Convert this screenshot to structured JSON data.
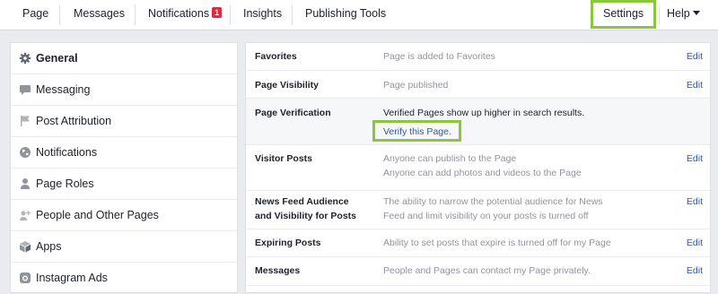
{
  "topnav": {
    "page": "Page",
    "messages": "Messages",
    "notifications": "Notifications",
    "notifications_count": "1",
    "insights": "Insights",
    "publishing_tools": "Publishing Tools",
    "settings": "Settings",
    "help": "Help"
  },
  "sidebar": {
    "items": [
      {
        "label": "General",
        "icon": "gear-icon"
      },
      {
        "label": "Messaging",
        "icon": "message-icon"
      },
      {
        "label": "Post Attribution",
        "icon": "flag-icon"
      },
      {
        "label": "Notifications",
        "icon": "globe-icon"
      },
      {
        "label": "Page Roles",
        "icon": "person-icon"
      },
      {
        "label": "People and Other Pages",
        "icon": "people-icon"
      },
      {
        "label": "Apps",
        "icon": "cube-icon"
      },
      {
        "label": "Instagram Ads",
        "icon": "camera-icon"
      }
    ]
  },
  "settings": {
    "edit_label": "Edit",
    "rows": [
      {
        "title": "Favorites",
        "lines": [
          "Page is added to Favorites"
        ]
      },
      {
        "title": "Page Visibility",
        "lines": [
          "Page published"
        ]
      },
      {
        "title": "Page Verification",
        "lines": [
          "Verified Pages show up higher in search results."
        ],
        "link": "Verify this Page."
      },
      {
        "title": "Visitor Posts",
        "lines": [
          "Anyone can publish to the Page",
          "Anyone can add photos and videos to the Page"
        ]
      },
      {
        "title": "News Feed Audience and Visibility for Posts",
        "lines": [
          "The ability to narrow the potential audience for News Feed and limit visibility on your posts is turned off"
        ]
      },
      {
        "title": "Expiring Posts",
        "lines": [
          "Ability to set posts that expire is turned off for my Page"
        ]
      },
      {
        "title": "Messages",
        "lines": [
          "People and Pages can contact my Page privately."
        ]
      }
    ]
  },
  "colors": {
    "highlight": "#8cc63f",
    "link": "#365899",
    "badge": "#e0293b"
  }
}
